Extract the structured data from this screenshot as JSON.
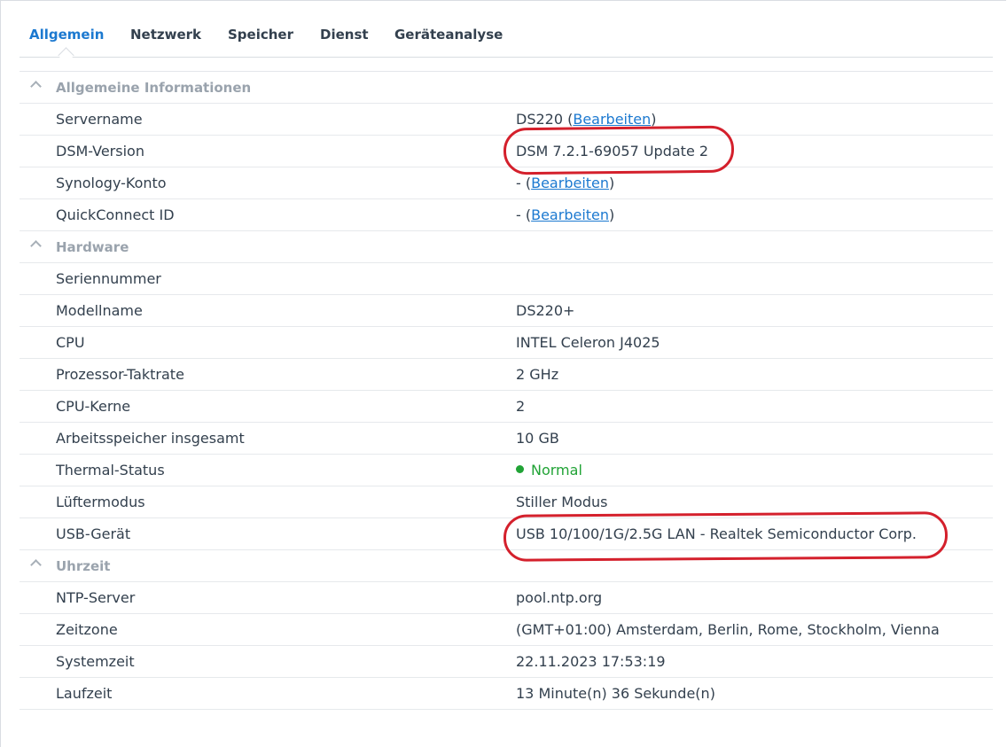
{
  "tabs": [
    {
      "label": "Allgemein",
      "active": true
    },
    {
      "label": "Netzwerk",
      "active": false
    },
    {
      "label": "Speicher",
      "active": false
    },
    {
      "label": "Dienst",
      "active": false
    },
    {
      "label": "Geräteanalyse",
      "active": false
    }
  ],
  "sections": {
    "general": {
      "title": "Allgemeine Informationen",
      "rows": [
        {
          "label": "Servername",
          "value": "DS220",
          "link": "Bearbeiten"
        },
        {
          "label": "DSM-Version",
          "value": "DSM 7.2.1-69057 Update 2"
        },
        {
          "label": "Synology-Konto",
          "value": "-",
          "link": "Bearbeiten"
        },
        {
          "label": "QuickConnect ID",
          "value": "-",
          "link": "Bearbeiten"
        }
      ]
    },
    "hardware": {
      "title": "Hardware",
      "rows": [
        {
          "label": "Seriennummer",
          "value": ""
        },
        {
          "label": "Modellname",
          "value": "DS220+"
        },
        {
          "label": "CPU",
          "value": "INTEL Celeron J4025"
        },
        {
          "label": "Prozessor-Taktrate",
          "value": "2 GHz"
        },
        {
          "label": "CPU-Kerne",
          "value": "2"
        },
        {
          "label": "Arbeitsspeicher insgesamt",
          "value": "10 GB"
        },
        {
          "label": "Thermal-Status",
          "value": "Normal"
        },
        {
          "label": "Lüftermodus",
          "value": "Stiller Modus"
        },
        {
          "label": "USB-Gerät",
          "value": "USB 10/100/1G/2.5G LAN - Realtek Semiconductor Corp."
        }
      ]
    },
    "time": {
      "title": "Uhrzeit",
      "rows": [
        {
          "label": "NTP-Server",
          "value": "pool.ntp.org"
        },
        {
          "label": "Zeitzone",
          "value": "(GMT+01:00) Amsterdam, Berlin, Rome, Stockholm, Vienna"
        },
        {
          "label": "Systemzeit",
          "value": "22.11.2023 17:53:19"
        },
        {
          "label": "Laufzeit",
          "value": "13 Minute(n) 36 Sekunde(n)"
        }
      ]
    }
  },
  "colors": {
    "accent": "#1c79d0",
    "status_ok": "#21a336",
    "annotation": "#d4202c"
  }
}
